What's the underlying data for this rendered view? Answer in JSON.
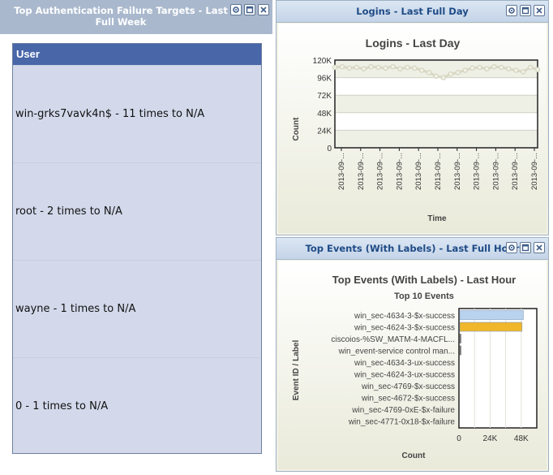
{
  "left_widget": {
    "title": "Top Authentication Failure Targets - Last Full Week",
    "table": {
      "header": "User",
      "rows": [
        "win-grks7vavk4n$ - 11 times to N/A",
        "root - 2 times to N/A",
        "wayne - 1 times to N/A",
        "0 - 1 times to N/A"
      ]
    }
  },
  "logins_widget": {
    "title": "Logins - Last Full Day",
    "chart_data": {
      "type": "line",
      "title": "Logins  - Last Day",
      "xlabel": "Time",
      "ylabel": "Count",
      "ylim": [
        0,
        120000
      ],
      "y_ticks": [
        "120K",
        "96K",
        "72K",
        "48K",
        "24K",
        "0"
      ],
      "x_ticks": [
        "2013-09-...",
        "2013-09-...",
        "2013-09-...",
        "2013-09-...",
        "2013-09-...",
        "2013-09-...",
        "2013-09-...",
        "2013-09-...",
        "2013-09-...",
        "2013-09-...",
        "2013-09-..."
      ],
      "series": [
        {
          "values": [
            110000,
            111000,
            109000,
            110000,
            108000,
            111000,
            110000,
            109000,
            111000,
            108000,
            110000,
            109000,
            106000,
            103000,
            98000,
            96000,
            101000,
            103000,
            106000,
            109000,
            110000,
            108000,
            111000,
            110000,
            108000,
            106000,
            104000,
            110000,
            107000
          ]
        }
      ],
      "grid": true,
      "color": "#d8d8c4"
    }
  },
  "events_widget": {
    "title": "Top Events (With Labels) - Last Full Hour",
    "chart_data": {
      "type": "bar",
      "orientation": "horizontal",
      "title": "Top Events (With Labels) - Last Hour",
      "subtitle": "Top 10 Events",
      "xlabel": "Count",
      "ylabel": "Event ID / Label",
      "xlim": [
        0,
        60000
      ],
      "x_ticks": [
        "0",
        "24K",
        "48K"
      ],
      "categories": [
        "win_sec-4634-3-$x-success",
        "win_sec-4624-3-$x-success",
        "ciscoios-%SW_MATM-4-MACFL...",
        "win_event-service control man...",
        "win_sec-4634-3-ux-success",
        "win_sec-4624-3-ux-success",
        "win_sec-4769-$x-success",
        "win_sec-4672-$x-success",
        "win_sec-4769-0xE-$x-failure",
        "win_sec-4771-0x18-$x-failure"
      ],
      "values": [
        49000,
        48000,
        400,
        300,
        0,
        0,
        0,
        0,
        0,
        0
      ],
      "colors": [
        "#b9d3ee",
        "#f0b72a",
        "#888888",
        "#888888",
        "#888888",
        "#888888",
        "#888888",
        "#888888",
        "#888888",
        "#888888"
      ]
    }
  }
}
